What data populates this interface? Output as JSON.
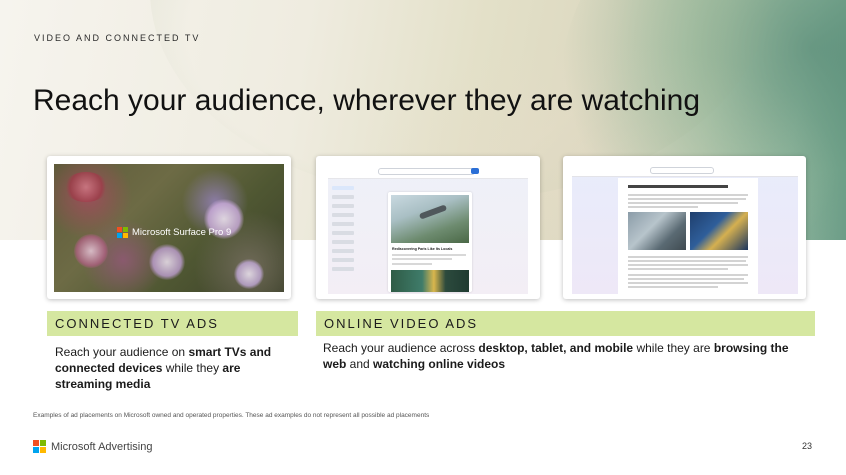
{
  "eyebrow": "VIDEO AND CONNECTED TV",
  "headline": "Reach your audience, wherever they are watching",
  "cards": {
    "ctv_video_brand": "Microsoft Surface Pro 9",
    "online_feed_title": "Rediscovering Paris Like Its Locals"
  },
  "sections": {
    "ctv": {
      "label": "CONNECTED TV ADS",
      "text_1": "Reach your audience on ",
      "bold_1": "smart TVs and connected devices",
      "text_2": " while they ",
      "bold_2": "are streaming media"
    },
    "online": {
      "label": "ONLINE VIDEO ADS",
      "text_1": "Reach your audience across ",
      "bold_1": "desktop, tablet, and mobile",
      "text_2": " while they are ",
      "bold_2": "browsing the web",
      "text_3": " and ",
      "bold_3": "watching online videos"
    }
  },
  "footnote": "Examples of ad placements on Microsoft owned and operated properties. These ad examples do not represent all possible ad placements",
  "footer": {
    "brand": "Microsoft Advertising",
    "page_number": "23"
  },
  "colors": {
    "band": "#d5e7a0",
    "logo_red": "#f25022",
    "logo_green": "#7fba00",
    "logo_blue": "#00a4ef",
    "logo_yellow": "#ffb900"
  },
  "icons": [
    "microsoft-logo-icon"
  ]
}
